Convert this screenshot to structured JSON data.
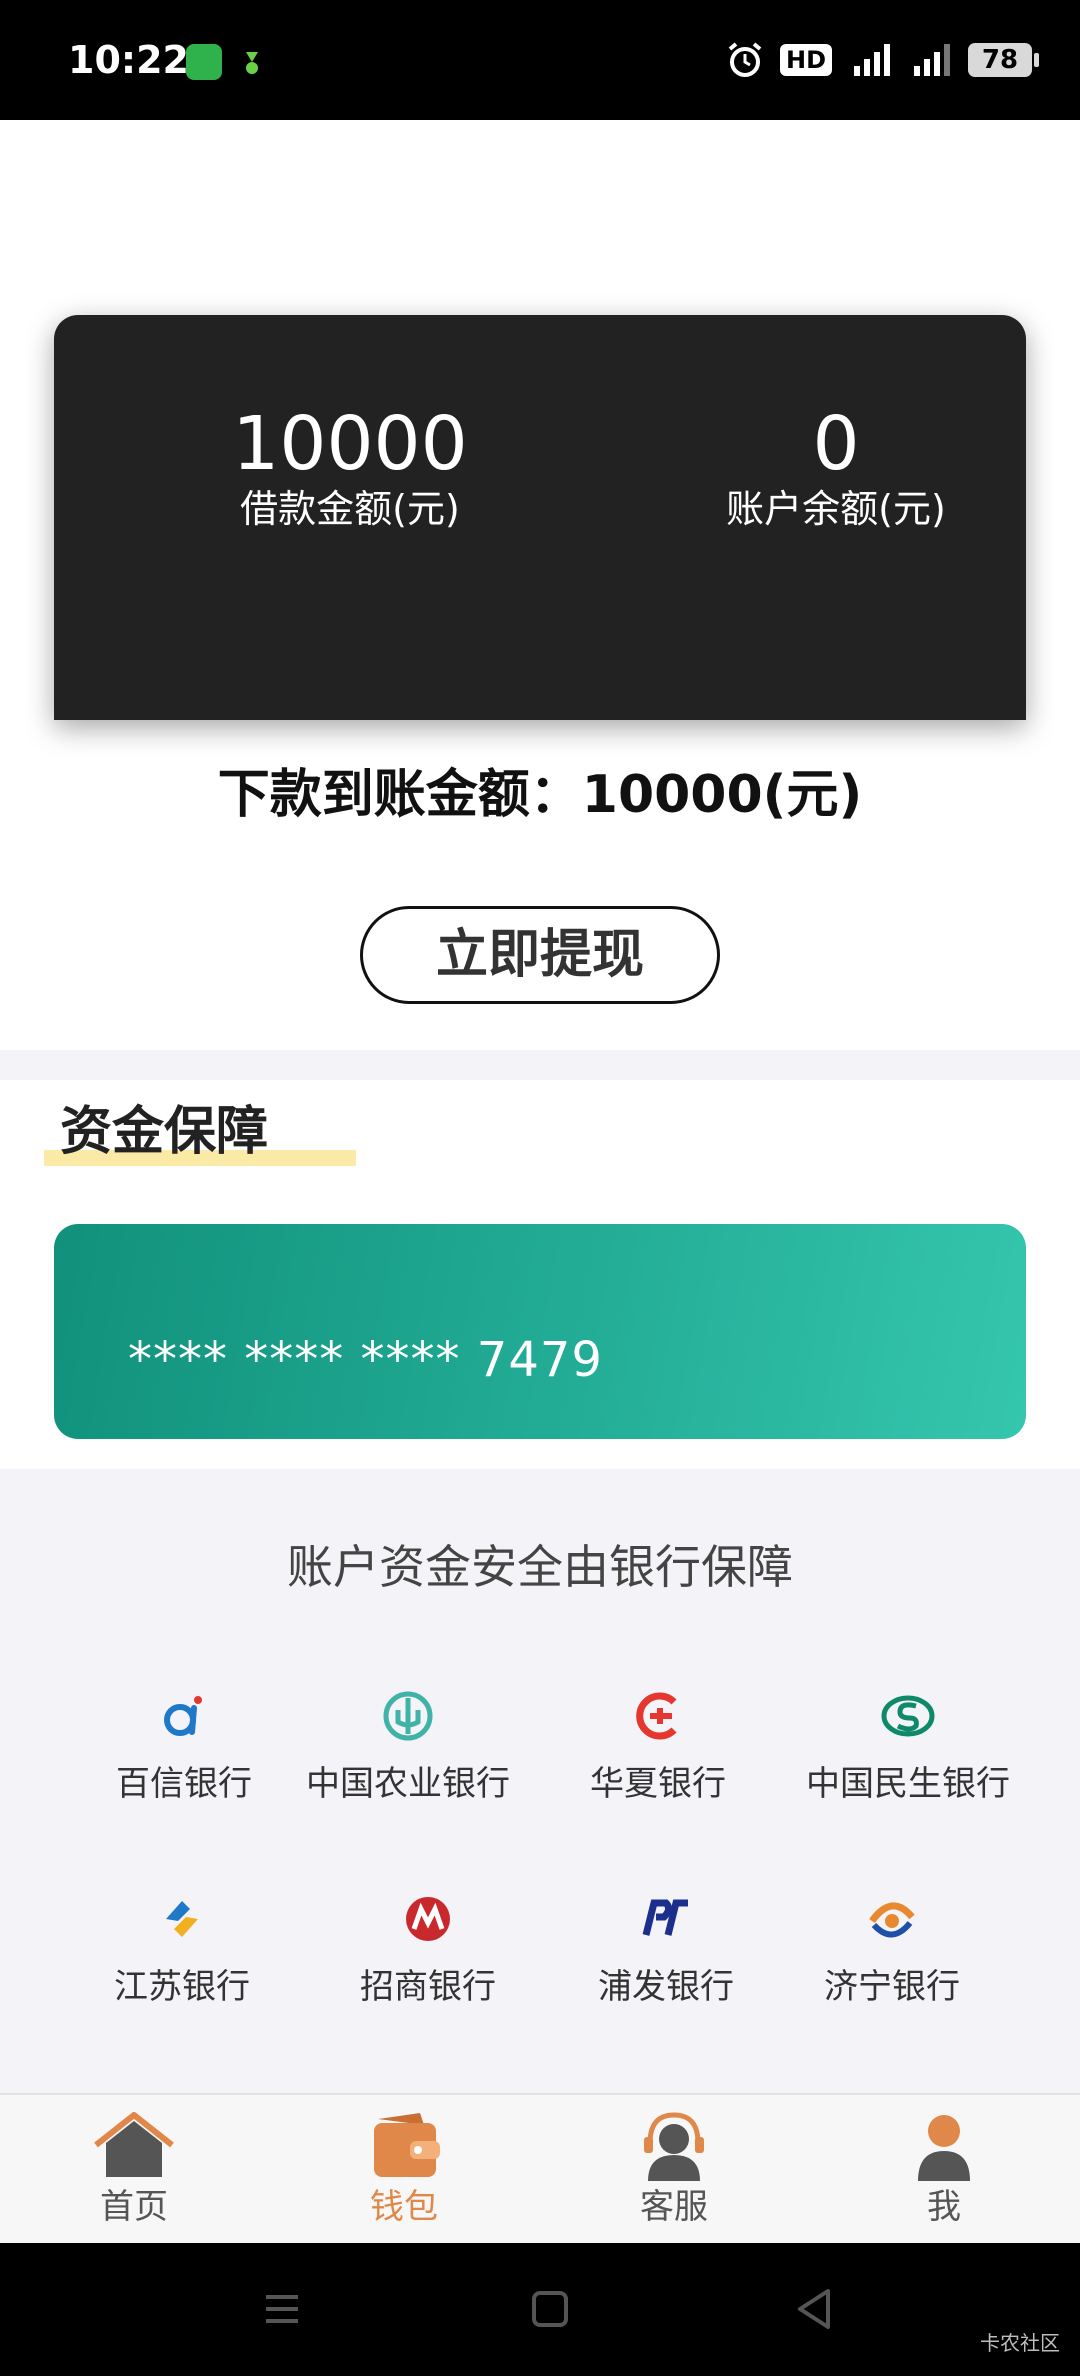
{
  "status_bar": {
    "time": "10:22",
    "hd_badge": "HD",
    "battery": "78",
    "icons": [
      "oppo-app-icon",
      "notification-icon",
      "alarm-icon",
      "signal-5g-icon",
      "signal-5g-icon-2",
      "battery-icon"
    ]
  },
  "summary": {
    "loan_amount_value": "10000",
    "loan_amount_label": "借款金额(元)",
    "balance_value": "0",
    "balance_label": "账户余额(元)"
  },
  "disbursement": {
    "text": "下款到账金额：10000(元)"
  },
  "actions": {
    "withdraw_label": "立即提现"
  },
  "fund_guarantee": {
    "title": "资金保障",
    "card_number": "**** **** **** 7479"
  },
  "banks": {
    "heading": "账户资金安全由银行保障",
    "items": [
      {
        "name": "百信银行",
        "logo": "aibank-logo",
        "color": "#1f78c8"
      },
      {
        "name": "中国农业银行",
        "logo": "abc-logo",
        "color": "#3fb3a7"
      },
      {
        "name": "华夏银行",
        "logo": "hxb-logo",
        "color": "#e5362f"
      },
      {
        "name": "中国民生银行",
        "logo": "cmbc-logo",
        "color": "#0e8a6a"
      },
      {
        "name": "江苏银行",
        "logo": "jsb-logo",
        "color": "#f2b01e"
      },
      {
        "name": "招商银行",
        "logo": "cmb-logo",
        "color": "#c9282d"
      },
      {
        "name": "浦发银行",
        "logo": "spdb-logo",
        "color": "#1d2f8c"
      },
      {
        "name": "济宁银行",
        "logo": "jnb-logo",
        "color": "#e8892f"
      }
    ]
  },
  "bottom_nav": {
    "items": [
      {
        "label": "首页",
        "icon": "home-icon"
      },
      {
        "label": "钱包",
        "icon": "wallet-icon",
        "active": true
      },
      {
        "label": "客服",
        "icon": "customer-service-icon"
      },
      {
        "label": "我",
        "icon": "profile-icon"
      }
    ],
    "active_color": "#e0884a"
  },
  "watermark": "卡农社区"
}
